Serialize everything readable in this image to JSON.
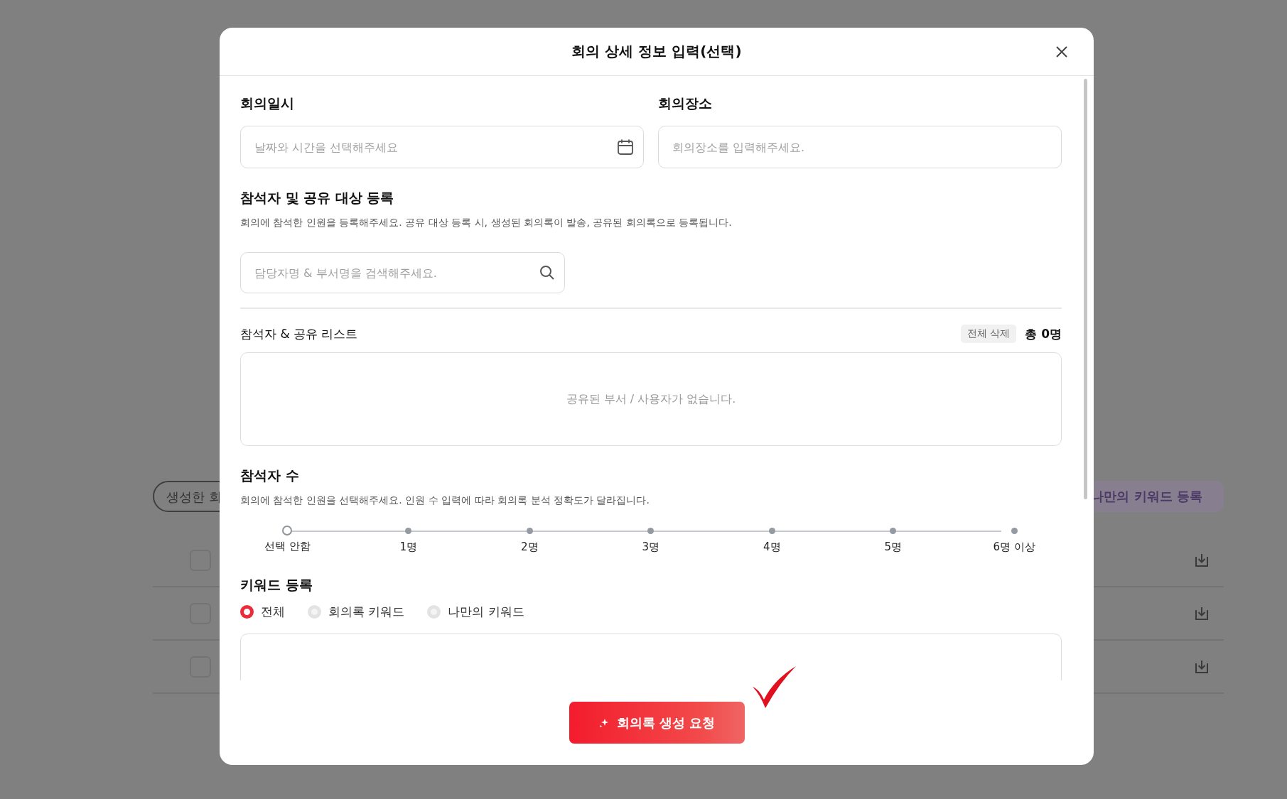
{
  "background": {
    "filter_chip": "생성한 회",
    "keyword_link": "나만의 키워드 등록",
    "rows": [
      {
        "checked": false
      },
      {
        "checked": false
      },
      {
        "checked": false
      }
    ]
  },
  "dialog": {
    "title": "회의 상세 정보 입력(선택)",
    "fields": [
      {
        "kind": "date",
        "label": "회의일시",
        "placeholder": "날짜와 시간을 선택해주세요"
      },
      {
        "kind": "text",
        "label": "회의장소",
        "placeholder": "회의장소를 입력해주세요."
      }
    ],
    "attendees": {
      "title": "참석자 및 공유 대상 등록",
      "description": "회의에 참석한 인원을 등록해주세요. 공유 대상 등록 시, 생성된 회의록이 발송, 공유된 회의록으로 등록됩니다.",
      "search": {
        "placeholder": "담당자명 & 부서명을 검색해주세요."
      }
    },
    "list": {
      "title": "참석자 & 공유 리스트",
      "clear_button": "전체 삭제",
      "total": "총 0명",
      "empty_message": "공유된 부서 / 사용자가 없습니다."
    },
    "participant_count": {
      "title": "참석자 수",
      "description": "회의에 참석한 인원을 선택해주세요. 인원 수 입력에 따라 회의록 분석 정확도가 달라집니다.",
      "options": [
        {
          "label": "선택 안함",
          "selected": true
        },
        {
          "label": "1명",
          "selected": false
        },
        {
          "label": "2명",
          "selected": false
        },
        {
          "label": "3명",
          "selected": false
        },
        {
          "label": "4명",
          "selected": false
        },
        {
          "label": "5명",
          "selected": false
        },
        {
          "label": "6명 이상",
          "selected": false
        }
      ]
    },
    "keywords": {
      "title": "키워드 등록",
      "options": [
        {
          "label": "전체",
          "selected": true
        },
        {
          "label": "회의록 키워드",
          "selected": false
        },
        {
          "label": "나만의 키워드",
          "selected": false
        }
      ]
    },
    "submit_button": "회의록 생성 요청"
  }
}
